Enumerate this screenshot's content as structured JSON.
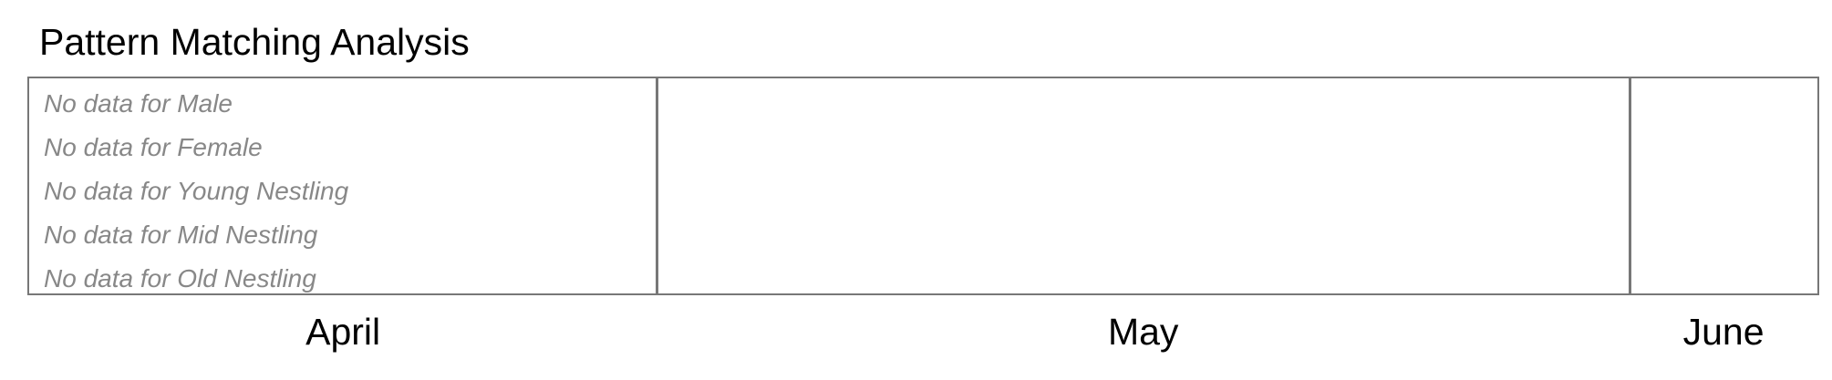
{
  "chart_data": {
    "type": "timeline",
    "title": "Pattern Matching Analysis",
    "months": [
      {
        "label": "April",
        "start_fraction": 0.0,
        "end_fraction": 0.351
      },
      {
        "label": "May",
        "start_fraction": 0.351,
        "end_fraction": 0.895
      },
      {
        "label": "June",
        "start_fraction": 0.895,
        "end_fraction": 1.0
      }
    ],
    "series": [
      {
        "name": "Male",
        "status": "No data for Male"
      },
      {
        "name": "Female",
        "status": "No data for Female"
      },
      {
        "name": "Young Nestling",
        "status": "No data for Young Nestling"
      },
      {
        "name": "Mid Nestling",
        "status": "No data for Mid Nestling"
      },
      {
        "name": "Old Nestling",
        "status": "No data for Old Nestling"
      }
    ],
    "colors": {
      "frame": "#777777",
      "no_data_text": "#888888"
    }
  }
}
